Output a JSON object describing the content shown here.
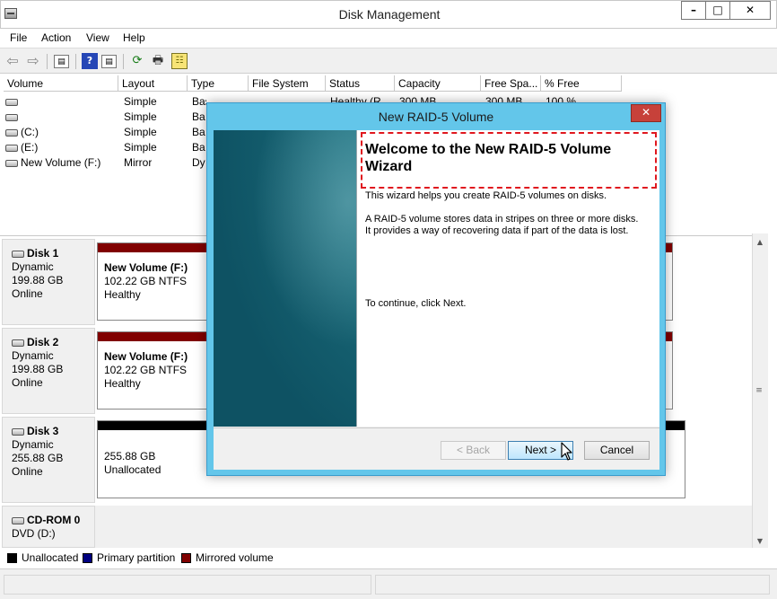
{
  "window": {
    "title": "Disk Management",
    "controls": {
      "minimize": "–",
      "maximize": "□",
      "close": "✕"
    }
  },
  "menu": [
    "File",
    "Action",
    "View",
    "Help"
  ],
  "toolbar": {
    "icons": [
      "back-arrow-icon",
      "forward-arrow-icon",
      "console-tree-icon",
      "help-icon",
      "properties-icon",
      "refresh-icon",
      "export-icon",
      "settings-icon"
    ],
    "glyphs": {
      "back": "⇦",
      "forward": "⇨",
      "tree": "▤",
      "help": "?",
      "properties": "▤",
      "refresh": "⟳",
      "export": "🖶",
      "settings": "☷"
    }
  },
  "volume_list": {
    "columns": [
      "Volume",
      "Layout",
      "Type",
      "File System",
      "Status",
      "Capacity",
      "Free Spa...",
      "% Free"
    ],
    "first_row_partial": {
      "type": "Basic",
      "status": "Healthy (R...",
      "capacity": "300 MB",
      "free": "300 MB",
      "pct": "100 %"
    },
    "rows": [
      {
        "volume": "",
        "layout": "Simple",
        "type": "Ba"
      },
      {
        "volume": "",
        "layout": "Simple",
        "type": "Ba"
      },
      {
        "volume": "(C:)",
        "layout": "Simple",
        "type": "Ba"
      },
      {
        "volume": "(E:)",
        "layout": "Simple",
        "type": "Ba"
      },
      {
        "volume": "New Volume (F:)",
        "layout": "Mirror",
        "type": "Dy"
      }
    ]
  },
  "disks": [
    {
      "name": "Disk 1",
      "type": "Dynamic",
      "size": "199.88 GB",
      "state": "Online",
      "partition": {
        "name": "New Volume  (F:)",
        "detail": "102.22 GB NTFS",
        "status": "Healthy"
      }
    },
    {
      "name": "Disk 2",
      "type": "Dynamic",
      "size": "199.88 GB",
      "state": "Online",
      "partition": {
        "name": "New Volume  (F:)",
        "detail": "102.22 GB NTFS",
        "status": "Healthy"
      }
    },
    {
      "name": "Disk 3",
      "type": "Dynamic",
      "size": "255.88 GB",
      "state": "Online",
      "partition": {
        "name": "",
        "detail": "255.88 GB",
        "status": "Unallocated"
      }
    },
    {
      "name": "CD-ROM 0",
      "type": "DVD (D:)",
      "size": "",
      "state": ""
    }
  ],
  "legend": [
    {
      "label": "Unallocated",
      "color": "#000000"
    },
    {
      "label": "Primary partition",
      "color": "#000080"
    },
    {
      "label": "Mirrored volume",
      "color": "#800000"
    }
  ],
  "colors": {
    "mirrored": "#800000",
    "unallocated": "#000000",
    "primary": "#000080",
    "dialog_frame": "#63c6ea",
    "highlight_box": "#e0181f"
  },
  "wizard": {
    "title": "New RAID-5 Volume",
    "close": "✕",
    "heading": "Welcome to the New RAID-5 Volume Wizard",
    "intro": "This wizard helps you create RAID-5 volumes on disks.",
    "desc1": "A RAID-5 volume stores data in stripes on three or more disks.",
    "desc2": "It provides a way of recovering data if part of the data is lost.",
    "continue": "To continue, click Next.",
    "buttons": {
      "back": "< Back",
      "next": "Next >",
      "cancel": "Cancel"
    }
  }
}
